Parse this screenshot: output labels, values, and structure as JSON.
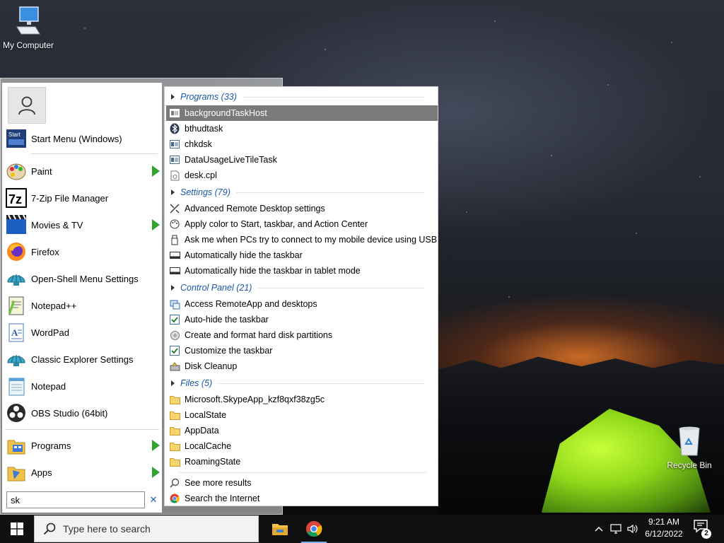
{
  "desktop": {
    "icons": [
      {
        "label": "My Computer"
      },
      {
        "label": "Recycle Bin"
      }
    ]
  },
  "start_menu": {
    "pinned": [
      {
        "label": "Start Menu (Windows)",
        "icon": "start-menu-icon"
      },
      {
        "label": "Paint",
        "icon": "paint-icon",
        "has_submenu": true
      },
      {
        "label": "7-Zip File Manager",
        "icon": "7zip-icon"
      },
      {
        "label": "Movies & TV",
        "icon": "movies-icon",
        "has_submenu": true
      },
      {
        "label": "Firefox",
        "icon": "firefox-icon"
      },
      {
        "label": "Open-Shell Menu Settings",
        "icon": "shell-icon"
      },
      {
        "label": "Notepad++",
        "icon": "notepadpp-icon"
      },
      {
        "label": "WordPad",
        "icon": "wordpad-icon"
      },
      {
        "label": "Classic Explorer Settings",
        "icon": "shell-icon"
      },
      {
        "label": "Notepad",
        "icon": "notepad-icon"
      },
      {
        "label": "OBS Studio (64bit)",
        "icon": "obs-icon"
      }
    ],
    "bottom": [
      {
        "label": "Programs",
        "icon": "programs-icon"
      },
      {
        "label": "Apps",
        "icon": "apps-icon"
      }
    ],
    "search_value": "sk",
    "search_clear": "✕",
    "results": {
      "programs": {
        "title": "Programs (33)",
        "items": [
          "backgroundTaskHost",
          "bthudtask",
          "chkdsk",
          "DataUsageLiveTileTask",
          "desk.cpl"
        ]
      },
      "settings": {
        "title": "Settings (79)",
        "items": [
          "Advanced Remote Desktop settings",
          "Apply color to Start, taskbar, and Action Center",
          "Ask me when PCs try to connect to my mobile device using USB",
          "Automatically hide the taskbar",
          "Automatically hide the taskbar in tablet mode"
        ]
      },
      "control_panel": {
        "title": "Control Panel (21)",
        "items": [
          "Access RemoteApp and desktops",
          "Auto-hide the taskbar",
          "Create and format hard disk partitions",
          "Customize the taskbar",
          "Disk Cleanup"
        ]
      },
      "files": {
        "title": "Files (5)",
        "items": [
          "Microsoft.SkypeApp_kzf8qxf38zg5c",
          "LocalState",
          "AppData",
          "LocalCache",
          "RoamingState"
        ]
      },
      "more": "See more results",
      "internet": "Search the Internet"
    }
  },
  "taskbar": {
    "search_placeholder": "Type here to search",
    "time": "9:21 AM",
    "date": "6/12/2022",
    "notification_count": "2"
  },
  "colors": {
    "category": "#1a57a8",
    "selected": "#7a7a7a",
    "arrow_green": "#2fa52f"
  }
}
